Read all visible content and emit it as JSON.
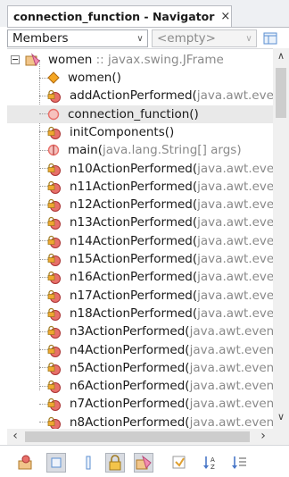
{
  "tab": {
    "title": "connection_function - Navigator",
    "close": "×"
  },
  "filter": {
    "members_label": "Members",
    "empty_label": "<empty>"
  },
  "root": {
    "name": "women",
    "sep": " :: ",
    "type": "javax.swing.JFrame"
  },
  "members": [
    {
      "name": "women()",
      "suffix": "",
      "kind": "constructor"
    },
    {
      "name": "addActionPerformed(",
      "suffix": "java.awt.even",
      "kind": "private-method"
    },
    {
      "name": "connection_function()",
      "suffix": "",
      "kind": "public-method",
      "selected": true
    },
    {
      "name": "initComponents()",
      "suffix": "",
      "kind": "private-method"
    },
    {
      "name": "main(",
      "suffix": "java.lang.String[] args)",
      "kind": "static-method"
    },
    {
      "name": "n10ActionPerformed(",
      "suffix": "java.awt.even",
      "kind": "private-method"
    },
    {
      "name": "n11ActionPerformed(",
      "suffix": "java.awt.even",
      "kind": "private-method"
    },
    {
      "name": "n12ActionPerformed(",
      "suffix": "java.awt.even",
      "kind": "private-method"
    },
    {
      "name": "n13ActionPerformed(",
      "suffix": "java.awt.even",
      "kind": "private-method"
    },
    {
      "name": "n14ActionPerformed(",
      "suffix": "java.awt.even",
      "kind": "private-method"
    },
    {
      "name": "n15ActionPerformed(",
      "suffix": "java.awt.even",
      "kind": "private-method"
    },
    {
      "name": "n16ActionPerformed(",
      "suffix": "java.awt.even",
      "kind": "private-method"
    },
    {
      "name": "n17ActionPerformed(",
      "suffix": "java.awt.even",
      "kind": "private-method"
    },
    {
      "name": "n18ActionPerformed(",
      "suffix": "java.awt.even",
      "kind": "private-method"
    },
    {
      "name": "n3ActionPerformed(",
      "suffix": "java.awt.event.",
      "kind": "private-method"
    },
    {
      "name": "n4ActionPerformed(",
      "suffix": "java.awt.event.",
      "kind": "private-method"
    },
    {
      "name": "n5ActionPerformed(",
      "suffix": "java.awt.event.",
      "kind": "private-method"
    },
    {
      "name": "n6ActionPerformed(",
      "suffix": "java.awt.event.",
      "kind": "private-method"
    },
    {
      "name": "n7ActionPerformed(",
      "suffix": "java.awt.event.",
      "kind": "private-method"
    },
    {
      "name": "n8ActionPerformed(",
      "suffix": "java.awt.event.",
      "kind": "private-method"
    }
  ],
  "colors": {
    "method_red": "#e8706a",
    "method_orange": "#f0a830",
    "constructor_orange": "#f5a623",
    "selection": "#e9e9e9"
  },
  "toolbar_icons": [
    "members-class-icon",
    "fields-toggle-icon",
    "static-toggle-icon",
    "lock-private-icon",
    "inherited-icon",
    "fqn-icon",
    "sort-by-name-icon",
    "sort-by-source-icon"
  ]
}
